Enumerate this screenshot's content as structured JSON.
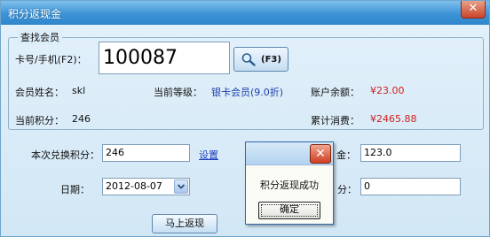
{
  "window": {
    "title": "积分返现金",
    "close_glyph": "✕"
  },
  "search_group": {
    "legend": "查找会员",
    "card_label": "卡号/手机(F2)：",
    "card_value": "100087",
    "search_button_label": "(F3)",
    "search_icon": "magnifier-icon"
  },
  "member": {
    "name_label": "会员姓名：",
    "name_value": "skl",
    "level_label": "当前等级：",
    "level_value": "银卡会员(9.0折)",
    "balance_label": "账户余额：",
    "balance_value": "¥23.00",
    "points_label": "当前积分：",
    "points_value": "246",
    "spent_label": "累计消费：",
    "spent_value": "¥2465.88"
  },
  "form": {
    "redeem_label": "本次兑换积分：",
    "redeem_value": "246",
    "settings_link": "设置",
    "cash_label_visible": "金：",
    "cash_value": "123.0",
    "date_label": "日期：",
    "date_value": "2012-08-07",
    "other_label_visible": "分：",
    "other_value": "0",
    "submit_label": "马上返现"
  },
  "dialog": {
    "close_glyph": "✕",
    "message": "积分返现成功",
    "ok_label": "确定"
  },
  "colors": {
    "title_bar": "#3d93d6",
    "window_bg": "#d8ebf7",
    "accent_blue_text": "#1b3fa8",
    "money_red": "#d21e1e",
    "dialog_close_red": "#cf3f22"
  }
}
